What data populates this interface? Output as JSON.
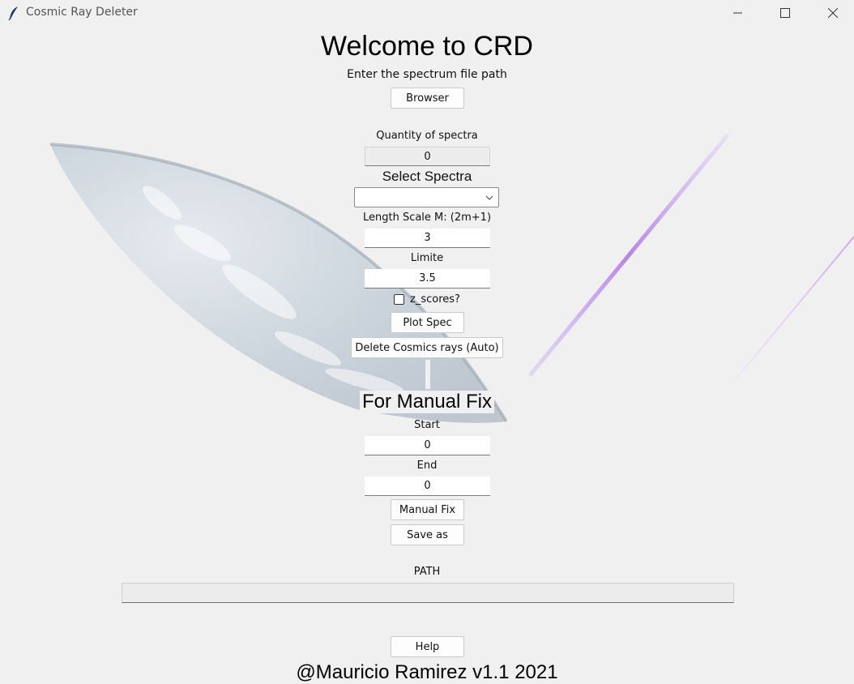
{
  "window": {
    "title": "Cosmic Ray Deleter"
  },
  "main": {
    "welcome": "Welcome to CRD",
    "file_prompt": "Enter the spectrum file path",
    "browser_label": "Browser",
    "quantity_label": "Quantity of spectra",
    "quantity_value": "0",
    "select_label": "Select Spectra",
    "select_value": "",
    "length_label": "Length Scale M: (2m+1)",
    "length_value": "3",
    "limite_label": "Limite",
    "limite_value": "3.5",
    "zscores_label": "z_scores?",
    "zscores_checked": false,
    "plot_label": "Plot Spec",
    "delete_label": "Delete Cosmics rays (Auto)",
    "manual_heading": "For Manual Fix",
    "start_label": "Start",
    "start_value": "0",
    "end_label": "End",
    "end_value": "0",
    "manual_fix_label": "Manual Fix",
    "save_as_label": "Save as",
    "path_label": "PATH",
    "path_value": "",
    "help_label": "Help",
    "footer": "@Mauricio Ramirez v1.1 2021"
  },
  "icons": {
    "app": "feather-icon",
    "minimize": "minimize-icon",
    "maximize": "maximize-icon",
    "close": "close-icon",
    "dropdown": "chevron-down-icon"
  },
  "colors": {
    "background": "#f0f0f0",
    "beam": "#b070e8"
  }
}
